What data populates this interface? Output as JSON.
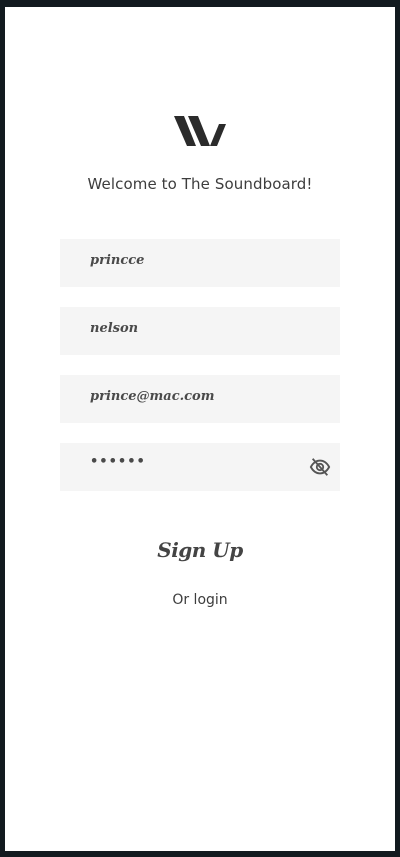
{
  "welcome_text": "Welcome to The Soundboard!",
  "fields": {
    "first_name": "princce",
    "last_name": "nelson",
    "email": "prince@mac.com",
    "password": "••••••"
  },
  "icons": {
    "logo": "soundboard-w-logo",
    "password_toggle": "eye-slash-icon"
  },
  "actions": {
    "signup_label": "Sign Up",
    "login_label": "Or login"
  },
  "colors": {
    "field_bg": "#f5f5f5",
    "text": "#3d3d3d"
  }
}
